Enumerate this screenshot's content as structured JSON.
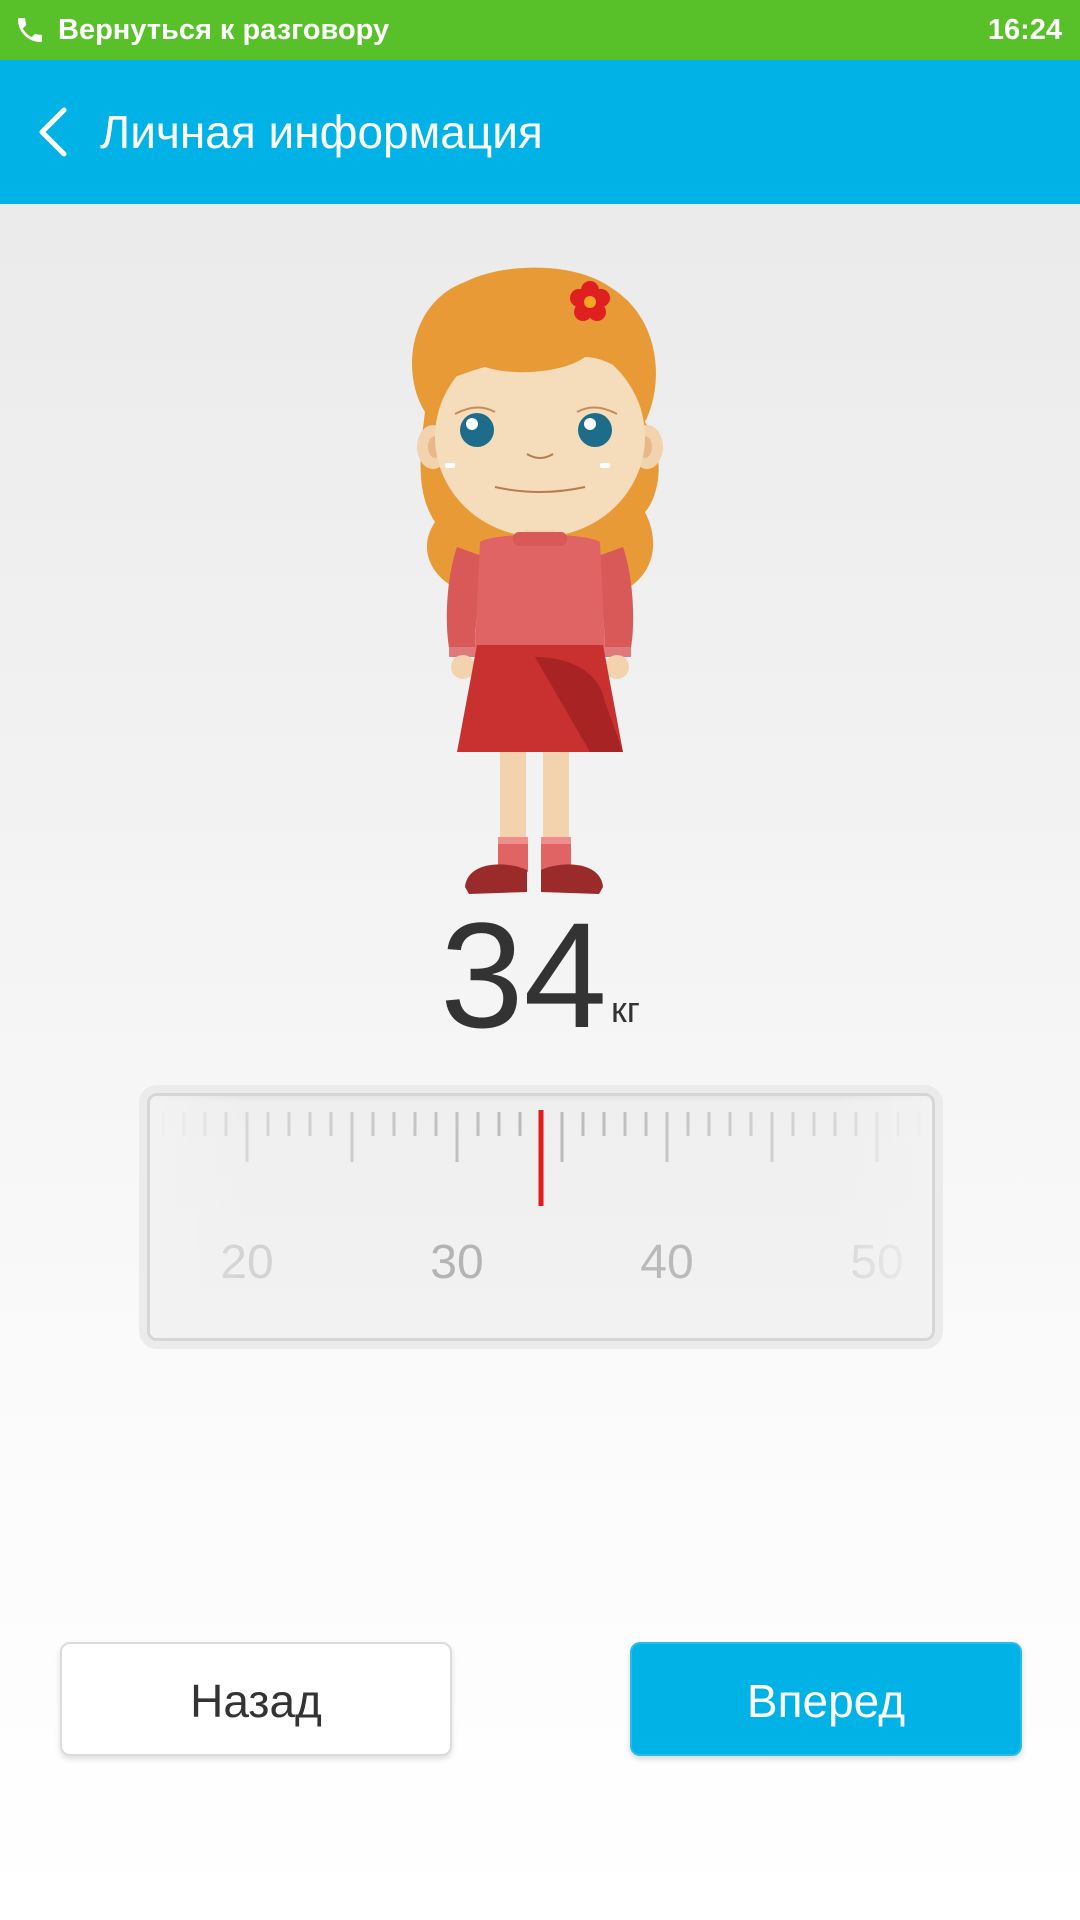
{
  "status_bar": {
    "call_text": "Вернуться к разговору",
    "time": "16:24",
    "icon": "phone-icon",
    "color": "#58c12a"
  },
  "app_bar": {
    "title": "Личная информация",
    "back_icon": "chevron-left-icon",
    "color": "#00b2e6"
  },
  "character": {
    "icon": "girl-avatar"
  },
  "weight": {
    "value": "34",
    "unit": "кг"
  },
  "ruler": {
    "min": 15,
    "max": 55,
    "labels": [
      "20",
      "30",
      "40",
      "50"
    ],
    "selected": 34,
    "indicator_color": "#e21b1b"
  },
  "buttons": {
    "back_label": "Назад",
    "next_label": "Вперед"
  }
}
